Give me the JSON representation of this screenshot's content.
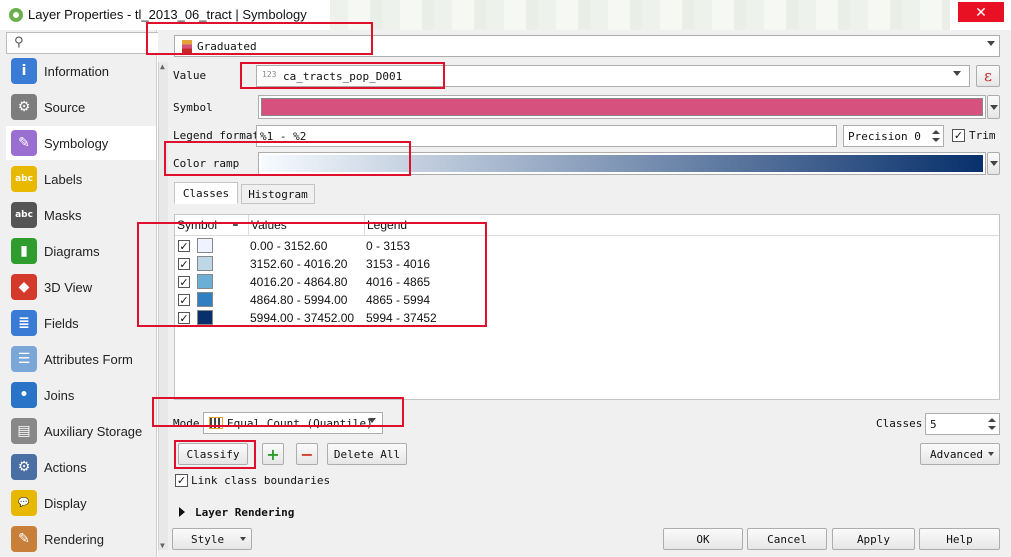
{
  "window": {
    "title": "Layer Properties - tl_2013_06_tract | Symbology",
    "close": "✕"
  },
  "sidebar": {
    "search_icon": "⚲",
    "items": [
      {
        "label": "Information",
        "icon": "information-icon",
        "color": "#3a7bd5",
        "glyph": "i"
      },
      {
        "label": "Source",
        "icon": "source-wrench-icon",
        "color": "#7d7d7d",
        "glyph": "⚙"
      },
      {
        "label": "Symbology",
        "icon": "symbology-brush-icon",
        "color": "#9b6fd1",
        "glyph": "✎"
      },
      {
        "label": "Labels",
        "icon": "labels-abc-icon",
        "color": "#e9b800",
        "glyph": "abc"
      },
      {
        "label": "Masks",
        "icon": "masks-abc-icon",
        "color": "#555555",
        "glyph": "abc"
      },
      {
        "label": "Diagrams",
        "icon": "diagrams-icon",
        "color": "#2e9d2e",
        "glyph": "▮"
      },
      {
        "label": "3D View",
        "icon": "3d-cube-icon",
        "color": "#d33a2c",
        "glyph": "◆"
      },
      {
        "label": "Fields",
        "icon": "fields-icon",
        "color": "#3a7bd5",
        "glyph": "≣"
      },
      {
        "label": "Attributes Form",
        "icon": "attributes-form-icon",
        "color": "#7aa6d8",
        "glyph": "☰"
      },
      {
        "label": "Joins",
        "icon": "joins-icon",
        "color": "#2a74c8",
        "glyph": "•"
      },
      {
        "label": "Auxiliary Storage",
        "icon": "auxiliary-storage-icon",
        "color": "#888888",
        "glyph": "▤"
      },
      {
        "label": "Actions",
        "icon": "actions-gear-icon",
        "color": "#4a6fa5",
        "glyph": "⚙"
      },
      {
        "label": "Display",
        "icon": "display-bubble-icon",
        "color": "#e8b700",
        "glyph": "💬"
      },
      {
        "label": "Rendering",
        "icon": "rendering-brush-icon",
        "color": "#c87f3a",
        "glyph": "✎"
      }
    ],
    "active": "Symbology"
  },
  "renderer": {
    "label": "Graduated"
  },
  "value": {
    "label": "Value",
    "type_badge": "123",
    "field": "ca_tracts_pop_D001",
    "expr_button": "ε"
  },
  "symbol": {
    "label": "Symbol",
    "color": "#d6517d"
  },
  "legend_format": {
    "label": "Legend format",
    "value": "%1 - %2",
    "precision_label": "Precision 0",
    "trim_label": "Trim"
  },
  "color_ramp": {
    "label": "Color ramp",
    "from": "#f7fbff",
    "to": "#08306b"
  },
  "tabs": [
    "Classes",
    "Histogram"
  ],
  "table": {
    "headers": [
      "Symbol",
      "Values",
      "Legend"
    ],
    "rows": [
      {
        "checked": "✓",
        "color": "#eff3ff",
        "values": "0.00 - 3152.60",
        "legend": "0 - 3153"
      },
      {
        "checked": "✓",
        "color": "#bdd7e7",
        "values": "3152.60 - 4016.20",
        "legend": "3153 - 4016"
      },
      {
        "checked": "✓",
        "color": "#6baed6",
        "values": "4016.20 - 4864.80",
        "legend": "4016 - 4865"
      },
      {
        "checked": "✓",
        "color": "#2f7fc1",
        "values": "4864.80 - 5994.00",
        "legend": "4865 - 5994"
      },
      {
        "checked": "✓",
        "color": "#08306b",
        "values": "5994.00 - 37452.00",
        "legend": "5994 - 37452"
      }
    ]
  },
  "mode": {
    "label": "Mode",
    "value": "Equal Count (Quantile)"
  },
  "classes": {
    "label": "Classes",
    "value": "5"
  },
  "buttons": {
    "classify": "Classify",
    "add": "+",
    "remove": "−",
    "delete_all": "Delete All",
    "advanced": "Advanced",
    "link_boundaries": "Link class boundaries",
    "layer_rendering": "Layer Rendering",
    "style": "Style",
    "ok": "OK",
    "cancel": "Cancel",
    "apply": "Apply",
    "help": "Help"
  },
  "annotation_color": "#e0102c"
}
